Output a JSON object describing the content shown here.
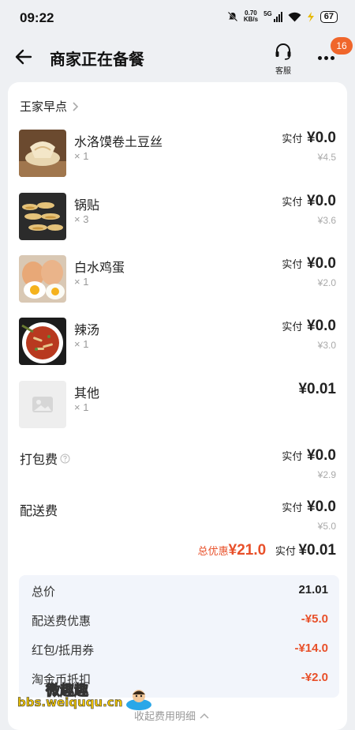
{
  "status": {
    "time": "09:22",
    "net_speed_value": "0.70",
    "net_speed_unit": "KB/s",
    "signal": "5G",
    "battery": "67"
  },
  "header": {
    "title": "商家正在备餐",
    "service_label": "客服",
    "badge": "16"
  },
  "shop": {
    "name": "王家早点"
  },
  "items": [
    {
      "name": "水洛馍卷土豆丝",
      "qty": "× 1",
      "paid_label": "实付",
      "paid": "¥0.0",
      "orig": "¥4.5",
      "thumb_icon": "bread-roll-image"
    },
    {
      "name": "锅贴",
      "qty": "× 3",
      "paid_label": "实付",
      "paid": "¥0.0",
      "orig": "¥3.6",
      "thumb_icon": "potstickers-image"
    },
    {
      "name": "白水鸡蛋",
      "qty": "× 1",
      "paid_label": "实付",
      "paid": "¥0.0",
      "orig": "¥2.0",
      "thumb_icon": "boiled-eggs-image"
    },
    {
      "name": "辣汤",
      "qty": "× 1",
      "paid_label": "实付",
      "paid": "¥0.0",
      "orig": "¥3.0",
      "thumb_icon": "spicy-soup-image"
    },
    {
      "name": "其他",
      "qty": "× 1",
      "paid_label": "",
      "paid": "¥0.01",
      "orig": "",
      "thumb_icon": "image-placeholder-icon"
    }
  ],
  "fees": [
    {
      "name": "打包费",
      "paid_label": "实付",
      "paid": "¥0.0",
      "orig": "¥2.9",
      "has_info": true
    },
    {
      "name": "配送费",
      "paid_label": "实付",
      "paid": "¥0.0",
      "orig": "¥5.0",
      "has_info": false
    }
  ],
  "totals": {
    "discount_label": "总优惠",
    "discount": "¥21.0",
    "paid_label": "实付",
    "paid": "¥0.01"
  },
  "breakdown": [
    {
      "label": "总价",
      "value": "21.01",
      "negative": false
    },
    {
      "label": "配送费优惠",
      "value": "-¥5.0",
      "negative": true
    },
    {
      "label": "红包/抵用券",
      "value": "-¥14.0",
      "negative": true
    },
    {
      "label": "淘金币抵扣",
      "value": "-¥2.0",
      "negative": true
    }
  ],
  "collapse_label": "收起费用明细",
  "watermark": {
    "text": "微趣趣",
    "url": "bbs.weiququ.cn"
  },
  "colors": {
    "accent": "#e8502a",
    "badge": "#f0662b",
    "panel": "#f2f5fb"
  }
}
